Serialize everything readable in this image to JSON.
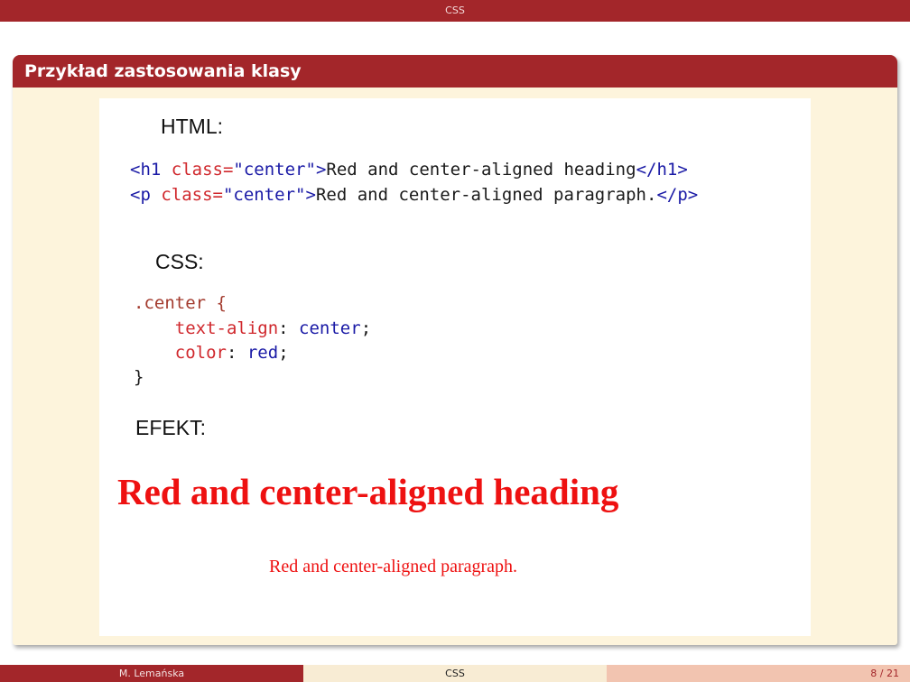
{
  "header": {
    "title": "CSS"
  },
  "block": {
    "title": "Przykład zastosowania klasy"
  },
  "figure": {
    "html_label": "HTML:",
    "html_lines": [
      {
        "open_lt": "<",
        "tag": "h1",
        "attr": " class=",
        "val": "\"center\"",
        "gt": ">",
        "text": "Red and center-aligned heading",
        "close": "</h1>"
      },
      {
        "open_lt": "<",
        "tag": "p",
        "attr": " class=",
        "val": "\"center\"",
        "gt": ">",
        "text": "Red and center-aligned paragraph.",
        "close": "</p>"
      }
    ],
    "css_label": "CSS:",
    "css": {
      "selector": ".center {",
      "decl1_prop": "text-align",
      "decl1_colon": ": ",
      "decl1_val": "center",
      "decl1_end": ";",
      "decl2_prop": "color",
      "decl2_colon": ": ",
      "decl2_val": "red",
      "decl2_end": ";",
      "close": "}"
    },
    "effect_label": "EFEKT:",
    "demo_heading": "Red and center-aligned heading",
    "demo_paragraph": "Red and center-aligned paragraph."
  },
  "footer": {
    "author": "M. Lemańska",
    "title": "CSS",
    "page": "8 / 21"
  },
  "colors": {
    "theme": "#a3262a",
    "block_bg": "#fdf4dc",
    "demo_red": "#ee1111"
  }
}
